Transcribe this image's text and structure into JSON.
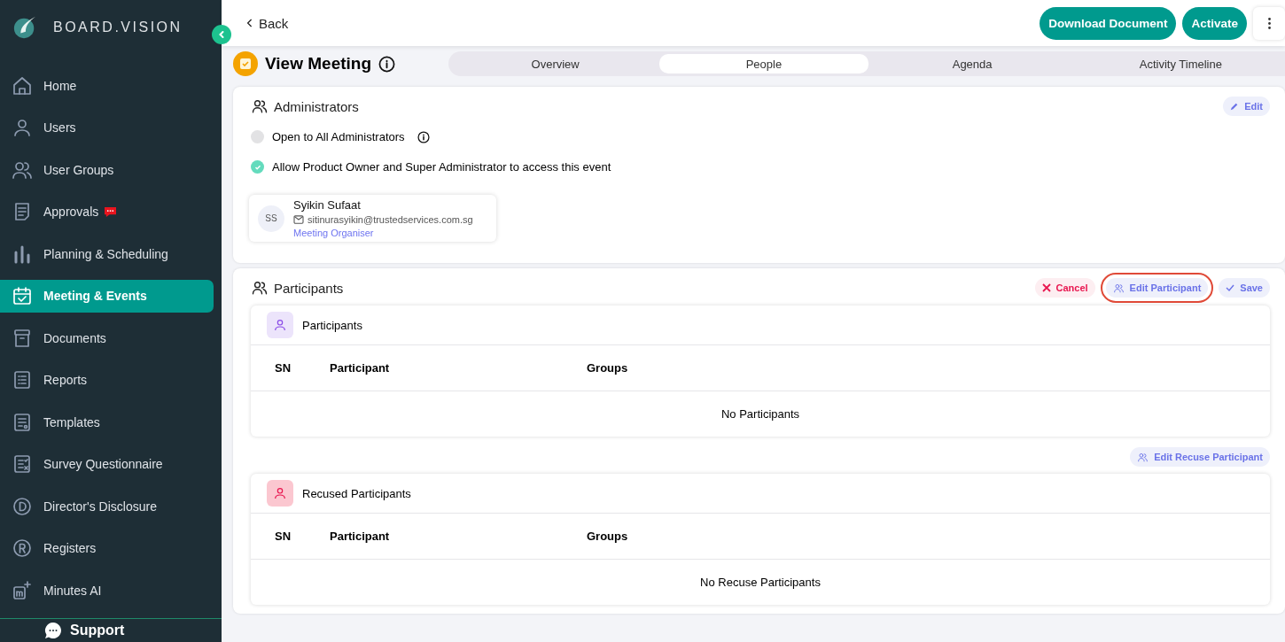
{
  "sidebar": {
    "brand": "BOARD.VISION",
    "items": [
      {
        "label": "Home",
        "selected": false,
        "alert": false
      },
      {
        "label": "Users",
        "selected": false,
        "alert": false
      },
      {
        "label": "User Groups",
        "selected": false,
        "alert": false
      },
      {
        "label": "Approvals",
        "selected": false,
        "alert": true
      },
      {
        "label": "Planning & Scheduling",
        "selected": false,
        "alert": false
      },
      {
        "label": "Meeting & Events",
        "selected": true,
        "alert": false
      },
      {
        "label": "Documents",
        "selected": false,
        "alert": false
      },
      {
        "label": "Reports",
        "selected": false,
        "alert": false
      },
      {
        "label": "Templates",
        "selected": false,
        "alert": false
      },
      {
        "label": "Survey Questionnaire",
        "selected": false,
        "alert": false
      },
      {
        "label": "Director's Disclosure",
        "selected": false,
        "alert": false
      },
      {
        "label": "Registers",
        "selected": false,
        "alert": false
      },
      {
        "label": "Minutes AI",
        "selected": false,
        "alert": false
      }
    ],
    "support": "Support"
  },
  "header": {
    "back": "Back",
    "buttons": [
      "Download Document",
      "Activate"
    ]
  },
  "page": {
    "title": "View Meeting",
    "tabs": [
      {
        "label": "Overview",
        "selected": false
      },
      {
        "label": "People",
        "selected": true
      },
      {
        "label": "Agenda",
        "selected": false
      },
      {
        "label": "Activity Timeline",
        "selected": false
      }
    ]
  },
  "administrators": {
    "title": "Administrators",
    "edit": "Edit",
    "options": [
      {
        "label": "Open to All Administrators",
        "checked": false,
        "info": true
      },
      {
        "label": "Allow Product Owner and Super Administrator to access this event",
        "checked": true,
        "info": false
      }
    ],
    "people": [
      {
        "initials": "SS",
        "name": "Syikin Sufaat",
        "email": "sitinurasyikin@trustedservices.com.sg",
        "role": "Meeting Organiser"
      }
    ]
  },
  "participants": {
    "title": "Participants",
    "actions": [
      {
        "kind": "cancel",
        "label": "Cancel",
        "highlighted": false
      },
      {
        "kind": "edit",
        "label": "Edit Participant",
        "highlighted": true
      },
      {
        "kind": "save",
        "label": "Save",
        "highlighted": false
      }
    ],
    "tables": [
      {
        "kind": "participants",
        "title": "Participants",
        "columns": [
          "SN",
          "Participant",
          "Groups"
        ],
        "empty": "No Participants"
      },
      {
        "kind": "recused",
        "title": "Recused Participants",
        "columns": [
          "SN",
          "Participant",
          "Groups"
        ],
        "empty": "No Recuse Participants",
        "action": "Edit Recuse Participant"
      }
    ]
  }
}
